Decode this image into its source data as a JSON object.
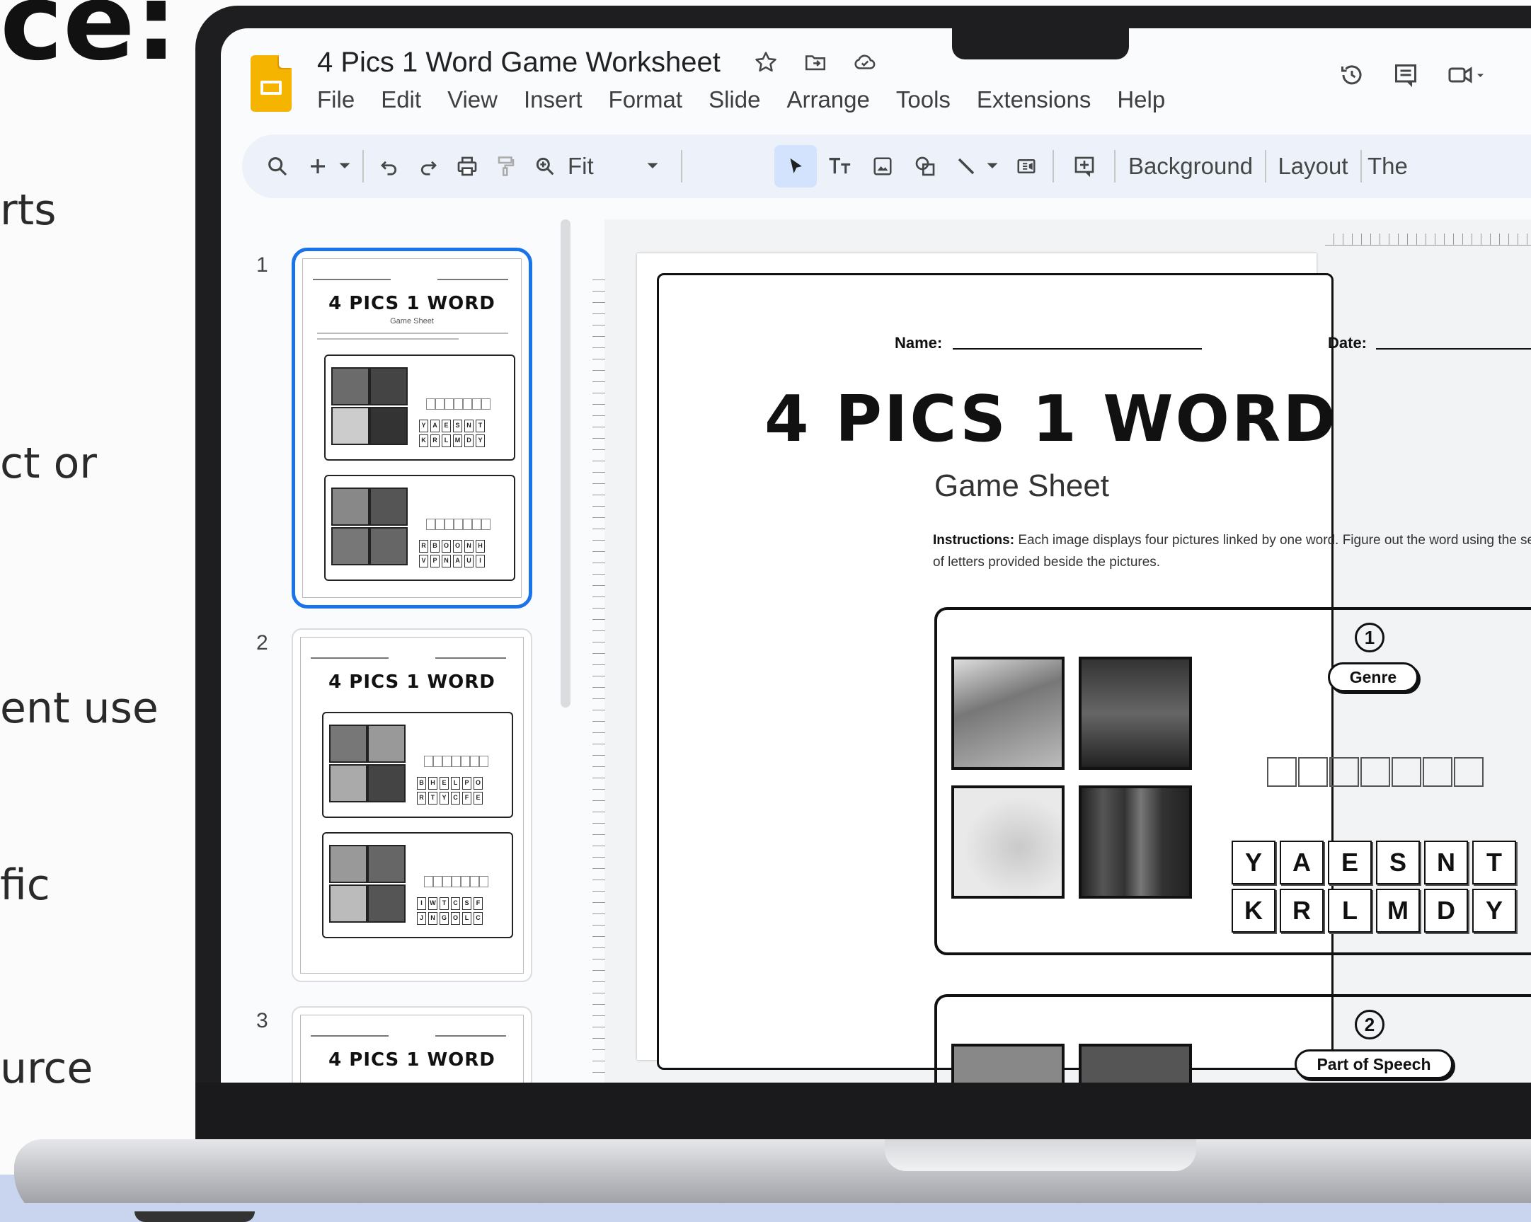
{
  "promo": {
    "title_fragment": "ce:",
    "side_fragments": [
      "rts",
      "ct or",
      "ent use",
      "fic",
      "urce"
    ]
  },
  "app": {
    "doc_title": "4 Pics 1 Word Game Worksheet",
    "menu": [
      "File",
      "Edit",
      "View",
      "Insert",
      "Format",
      "Slide",
      "Arrange",
      "Tools",
      "Extensions",
      "Help"
    ],
    "toolbar": {
      "zoom": "Fit",
      "background": "Background",
      "layout": "Layout",
      "theme": "The"
    }
  },
  "filmstrip": {
    "slides": [
      {
        "num": "1",
        "title": "4 PICS 1 WORD",
        "sub": "Game Sheet",
        "grid_a": [
          "Y",
          "A",
          "E",
          "S",
          "N",
          "T",
          "K",
          "R",
          "L",
          "M",
          "D",
          "Y"
        ],
        "grid_b": [
          "R",
          "B",
          "O",
          "O",
          "N",
          "H",
          "V",
          "P",
          "N",
          "A",
          "U",
          "I"
        ]
      },
      {
        "num": "2",
        "title": "4 PICS 1 WORD",
        "grid_a": [
          "B",
          "H",
          "E",
          "L",
          "P",
          "O",
          "R",
          "T",
          "Y",
          "C",
          "F",
          "E"
        ],
        "grid_b": [
          "I",
          "W",
          "T",
          "C",
          "S",
          "F",
          "J",
          "N",
          "G",
          "O",
          "L",
          "C"
        ]
      },
      {
        "num": "3",
        "title": "4 PICS 1 WORD"
      }
    ]
  },
  "worksheet": {
    "name_label": "Name:",
    "date_label": "Date:",
    "title": "4 PICS 1 WORD",
    "subtitle": "Game Sheet",
    "instructions_label": "Instructions:",
    "instructions_text": " Each image displays four pictures linked by one word. Figure out the word using the set of letters provided beside the pictures.",
    "puzzles": [
      {
        "number": "1",
        "category": "Genre",
        "blank_count": 7,
        "letters": [
          "Y",
          "A",
          "E",
          "S",
          "N",
          "T",
          "K",
          "R",
          "L",
          "M",
          "D",
          "Y"
        ]
      },
      {
        "number": "2",
        "category": "Part of Speech"
      }
    ]
  },
  "colors": {
    "slides_yellow": "#f4b400",
    "toolbar_bg": "#edf2fa",
    "selection_blue": "#1a73e8"
  }
}
